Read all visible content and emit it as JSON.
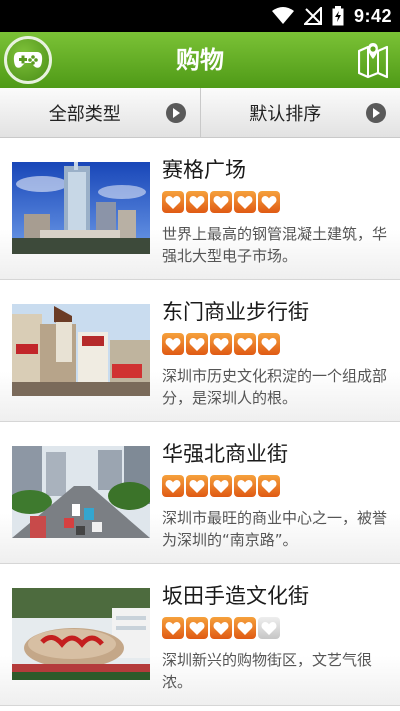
{
  "status_bar": {
    "time": "9:42",
    "icons": [
      "wifi-icon",
      "no-signal-icon",
      "battery-charging-icon"
    ]
  },
  "app_bar": {
    "title": "购物",
    "left_icon": "gamepad-icon",
    "right_icon": "map-icon"
  },
  "filters": [
    {
      "label": "全部类型",
      "icon": "arrow-right-circle-icon"
    },
    {
      "label": "默认排序",
      "icon": "arrow-right-circle-icon"
    }
  ],
  "colors": {
    "appbar": "#5fa51f",
    "star_on": "#ec7a24",
    "star_off": "#d4d4d4"
  },
  "items": [
    {
      "name": "赛格广场",
      "rating": 5,
      "max_rating": 5,
      "description": "世界上最高的钢管混凝土建筑，华强北大型电子市场。"
    },
    {
      "name": "东门商业步行街",
      "rating": 5,
      "max_rating": 5,
      "description": "深圳市历史文化积淀的一个组成部分，是深圳人的根。"
    },
    {
      "name": "华强北商业街",
      "rating": 5,
      "max_rating": 5,
      "description": "深圳市最旺的商业中心之一，被誉为深圳的“南京路”。"
    },
    {
      "name": "坂田手造文化街",
      "rating": 4,
      "max_rating": 5,
      "description": "深圳新兴的购物街区，文艺气很浓。"
    }
  ]
}
